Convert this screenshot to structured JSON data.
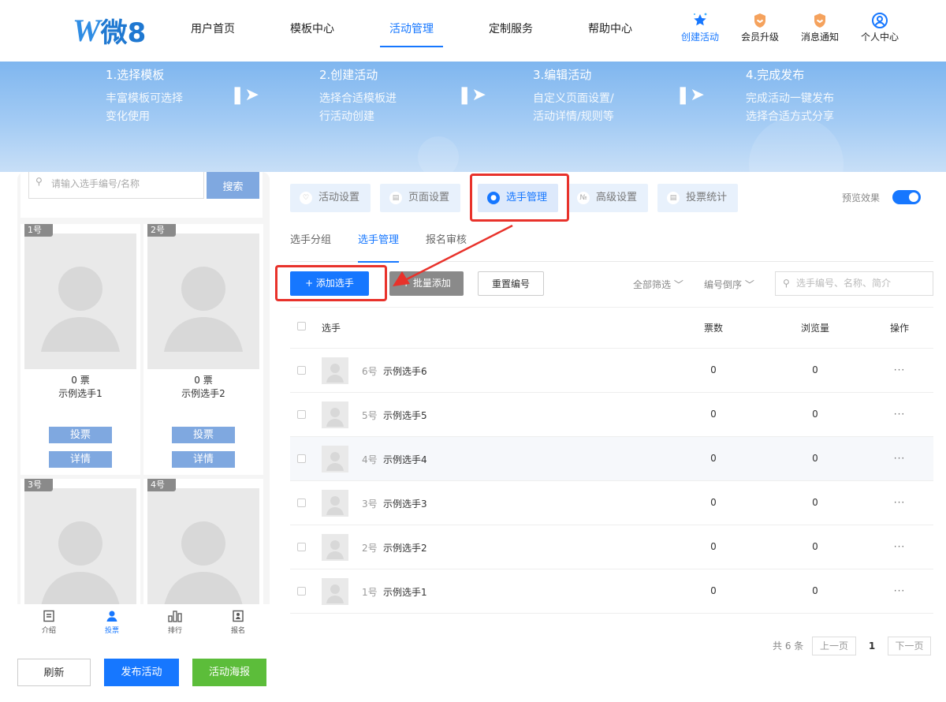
{
  "header": {
    "logo_text": "微8",
    "nav": [
      "用户首页",
      "模板中心",
      "活动管理",
      "定制服务",
      "帮助中心"
    ],
    "icons": [
      {
        "label": "创建活动",
        "icon": "star-sparkle-icon"
      },
      {
        "label": "会员升级",
        "icon": "shield-badge-icon"
      },
      {
        "label": "消息通知",
        "icon": "shield-badge-icon"
      },
      {
        "label": "个人中心",
        "icon": "user-circle-icon"
      }
    ]
  },
  "banner": {
    "steps": [
      {
        "title": "1.选择模板",
        "line1": "丰富模板可选择",
        "line2": "变化使用"
      },
      {
        "title": "2.创建活动",
        "line1": "选择合适模板进",
        "line2": "行活动创建"
      },
      {
        "title": "3.编辑活动",
        "line1": "自定义页面设置/",
        "line2": "活动详情/规则等"
      },
      {
        "title": "4.完成发布",
        "line1": "完成活动一键发布",
        "line2": "选择合适方式分享"
      }
    ]
  },
  "preview": {
    "search_placeholder": "请输入选手编号/名称",
    "search_button": "搜索",
    "cards": [
      {
        "num": "1号",
        "votes": "0 票",
        "name": "示例选手1"
      },
      {
        "num": "2号",
        "votes": "0 票",
        "name": "示例选手2"
      },
      {
        "num": "3号"
      },
      {
        "num": "4号"
      }
    ],
    "vote_button": "投票",
    "detail_button": "详情",
    "bottom_tabs": [
      "介绍",
      "投票",
      "排行",
      "报名"
    ]
  },
  "actions": {
    "refresh": "刷新",
    "publish": "发布活动",
    "poster": "活动海报"
  },
  "tabs": [
    "活动设置",
    "页面设置",
    "选手管理",
    "高级设置",
    "投票统计"
  ],
  "preview_toggle": {
    "label": "预览效果",
    "on": true
  },
  "subtabs": [
    "选手分组",
    "选手管理",
    "报名审核"
  ],
  "toolbar": {
    "add": "+ 添加选手",
    "batch": "+ 批量添加",
    "renumber": "重置编号",
    "filter": "全部筛选 ﹀",
    "sort": "编号倒序 ﹀",
    "search_placeholder": "选手编号、名称、简介"
  },
  "table": {
    "headers": {
      "player": "选手",
      "votes": "票数",
      "views": "浏览量",
      "ops": "操作"
    },
    "rows": [
      {
        "num": "6号",
        "name": "示例选手6",
        "votes": "0",
        "views": "0",
        "ops": "···"
      },
      {
        "num": "5号",
        "name": "示例选手5",
        "votes": "0",
        "views": "0",
        "ops": "···"
      },
      {
        "num": "4号",
        "name": "示例选手4",
        "votes": "0",
        "views": "0",
        "ops": "···"
      },
      {
        "num": "3号",
        "name": "示例选手3",
        "votes": "0",
        "views": "0",
        "ops": "···"
      },
      {
        "num": "2号",
        "name": "示例选手2",
        "votes": "0",
        "views": "0",
        "ops": "···"
      },
      {
        "num": "1号",
        "name": "示例选手1",
        "votes": "0",
        "views": "0",
        "ops": "···"
      }
    ]
  },
  "pagination": {
    "total": "共 6 条",
    "prev": "上一页",
    "page": "1",
    "next": "下一页"
  },
  "colors": {
    "primary": "#1677ff",
    "annotation": "#e8322b",
    "poster": "#5cbd3a"
  }
}
